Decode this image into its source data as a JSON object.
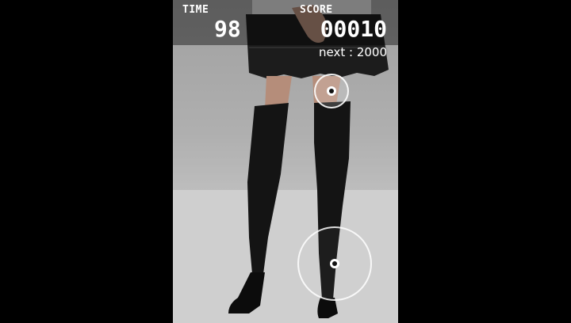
{
  "hud": {
    "time_label": "TIME",
    "time_value": "98",
    "score_label": "SCORE",
    "score_value": "00010",
    "next_text": "next : 2000"
  },
  "colors": {
    "frame": "#000000",
    "hud_text": "#ffffff",
    "backdrop": "#b3b3b3",
    "stockings": "#141414",
    "skirt": "#1c1c1c"
  },
  "icons": {
    "target_small": "target-ring-icon",
    "target_large": "target-ring-icon"
  }
}
